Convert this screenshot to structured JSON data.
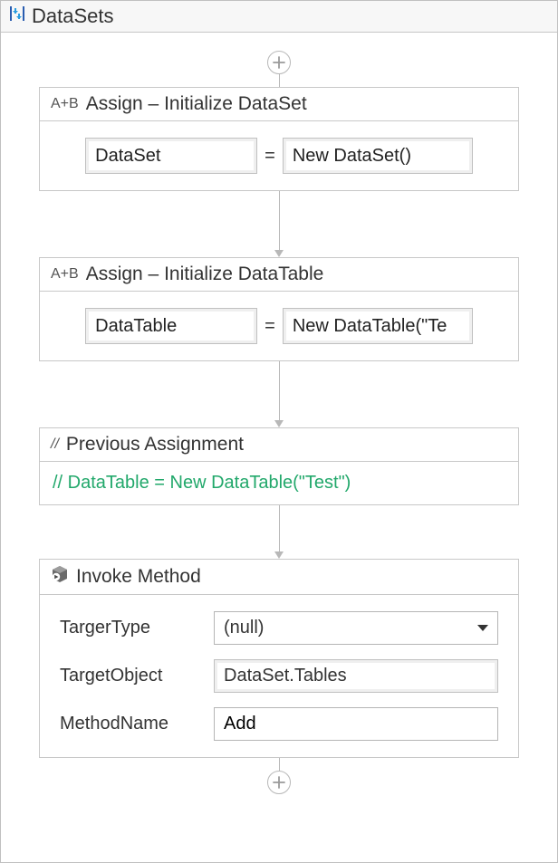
{
  "window": {
    "title": "DataSets"
  },
  "flow": {
    "assign1": {
      "prefix": "A+B",
      "title": "Assign – Initialize DataSet",
      "left": "DataSet",
      "right": "New DataSet()"
    },
    "assign2": {
      "prefix": "A+B",
      "title": "Assign – Initialize DataTable",
      "left": "DataTable",
      "right": "New DataTable(\"Te"
    },
    "comment": {
      "prefix": "//",
      "title": "Previous Assignment",
      "text": "// DataTable = New DataTable(\"Test\")"
    },
    "invoke": {
      "title": "Invoke Method",
      "rows": {
        "targetTypeLabel": "TargerType",
        "targetTypeValue": "(null)",
        "targetObjectLabel": "TargetObject",
        "targetObjectValue": "DataSet.Tables",
        "methodNameLabel": "MethodName",
        "methodNameValue": "Add"
      }
    }
  }
}
